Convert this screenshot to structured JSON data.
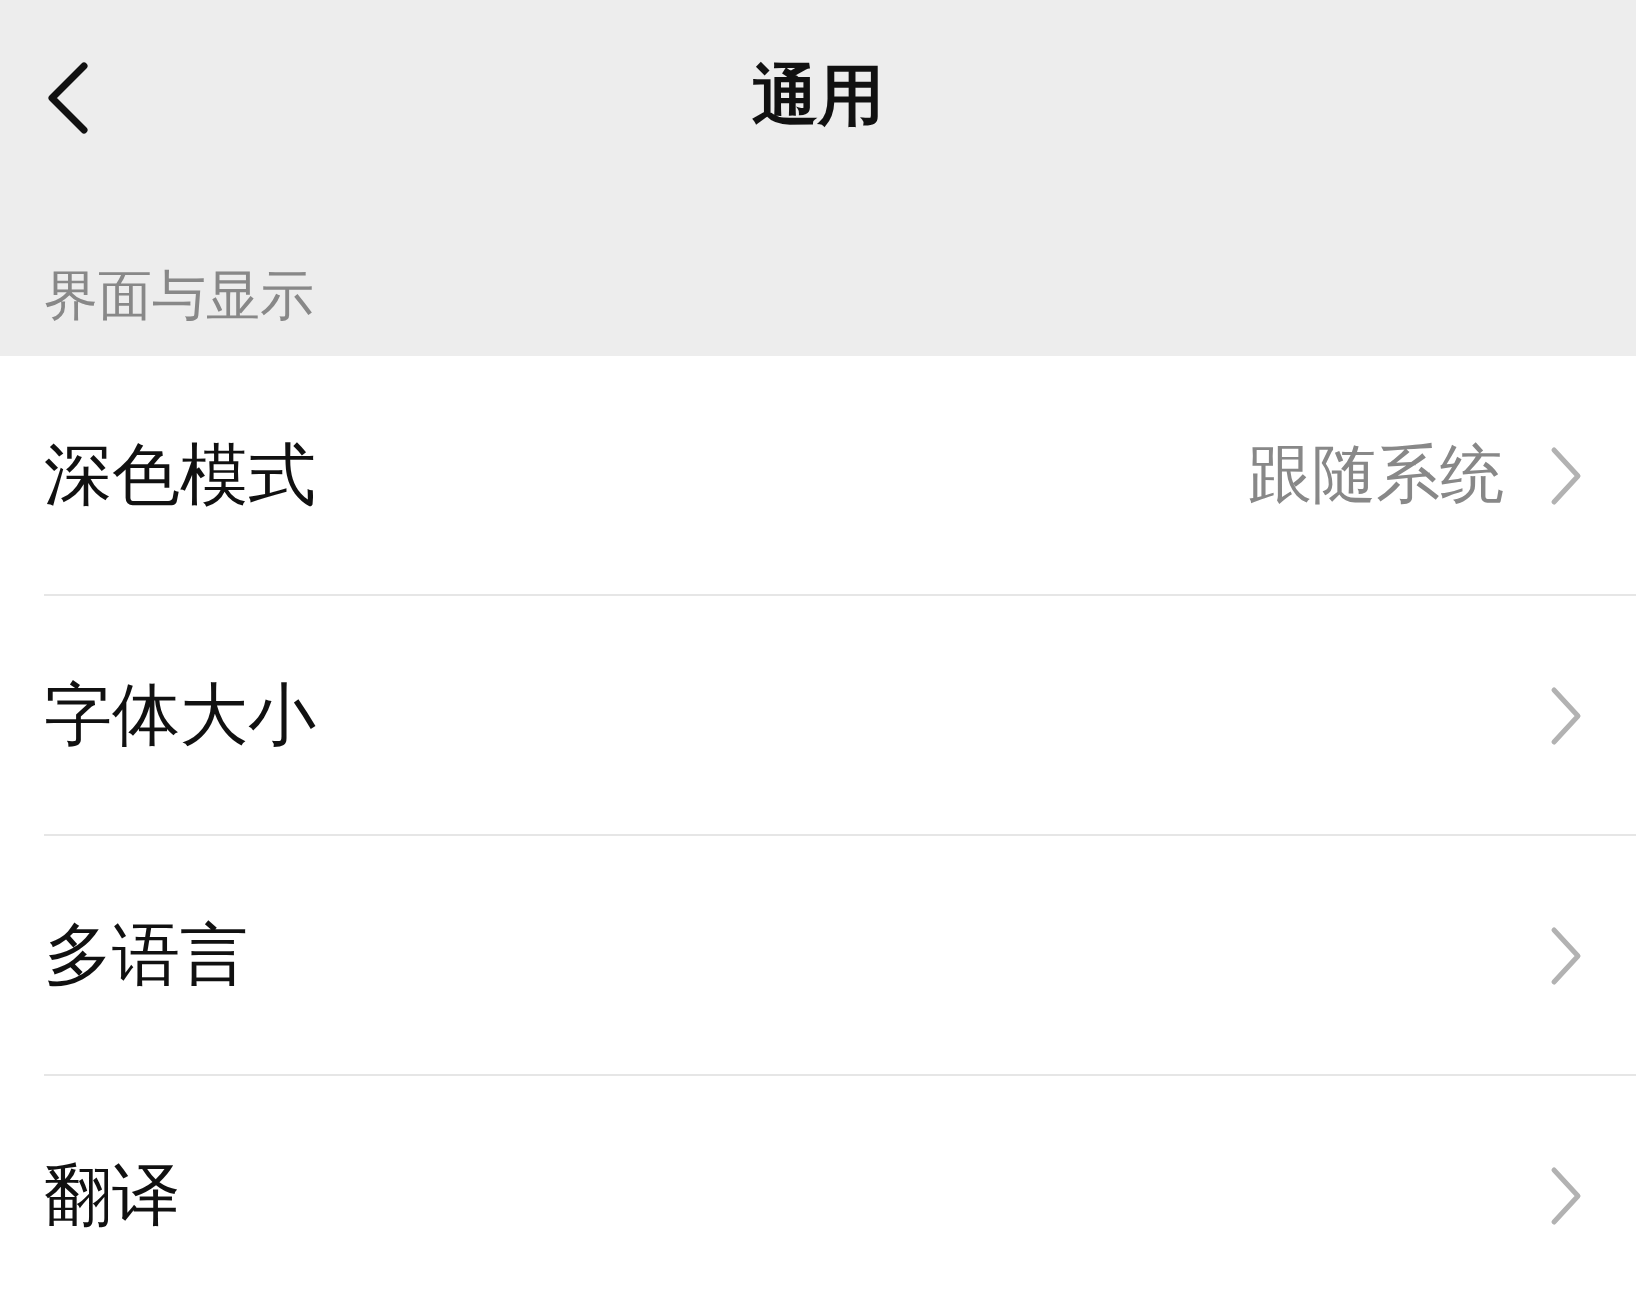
{
  "header": {
    "title": "通用"
  },
  "section": {
    "label": "界面与显示"
  },
  "items": [
    {
      "label": "深色模式",
      "value": "跟随系统"
    },
    {
      "label": "字体大小"
    },
    {
      "label": "多语言"
    },
    {
      "label": "翻译"
    }
  ]
}
